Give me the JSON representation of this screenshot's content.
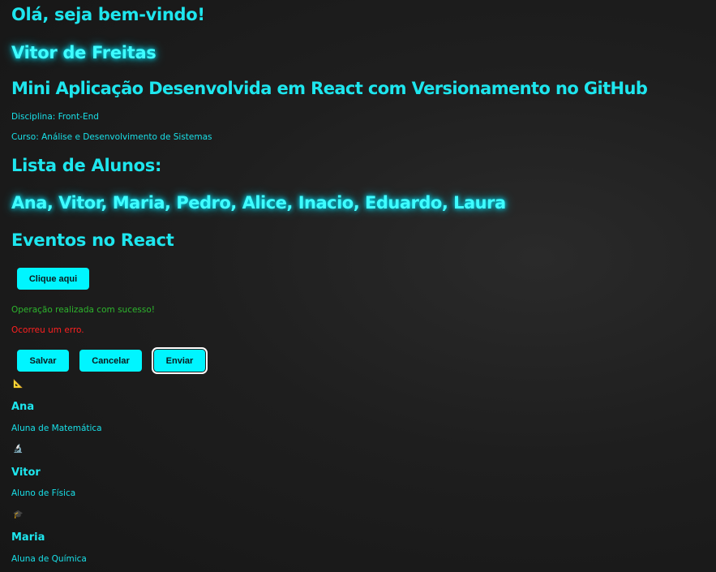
{
  "header": {
    "greeting": "Olá, seja bem-vindo!",
    "name": "Vitor de Freitas",
    "subtitle": "Mini Aplicação Desenvolvida em React com Versionamento no GitHub",
    "discipline": "Disciplina: Front-End",
    "course": "Curso: Análise e Desenvolvimento de Sistemas"
  },
  "students": {
    "title": "Lista de Alunos:",
    "names": "Ana, Vitor, Maria, Pedro, Alice, Inacio, Eduardo, Laura"
  },
  "events": {
    "title": "Eventos no React",
    "click_button": "Clique aqui",
    "success_message": "Operação realizada com sucesso!",
    "error_message": "Ocorreu um erro.",
    "save_button": "Salvar",
    "cancel_button": "Cancelar",
    "send_button": "Enviar"
  },
  "cards": [
    {
      "icon": "📐",
      "icon_name": "ruler-triangle-icon",
      "name": "Ana",
      "description": "Aluna de Matemática"
    },
    {
      "icon": "🔬",
      "icon_name": "microscope-icon",
      "name": "Vitor",
      "description": "Aluno de Física"
    },
    {
      "icon": "🎓",
      "icon_name": "graduation-cap-icon",
      "name": "Maria",
      "description": "Aluna de Química"
    }
  ],
  "colors": {
    "accent": "#00f5ff",
    "background": "#1e1e1e",
    "success": "#2db52d",
    "error": "#ff2020"
  }
}
